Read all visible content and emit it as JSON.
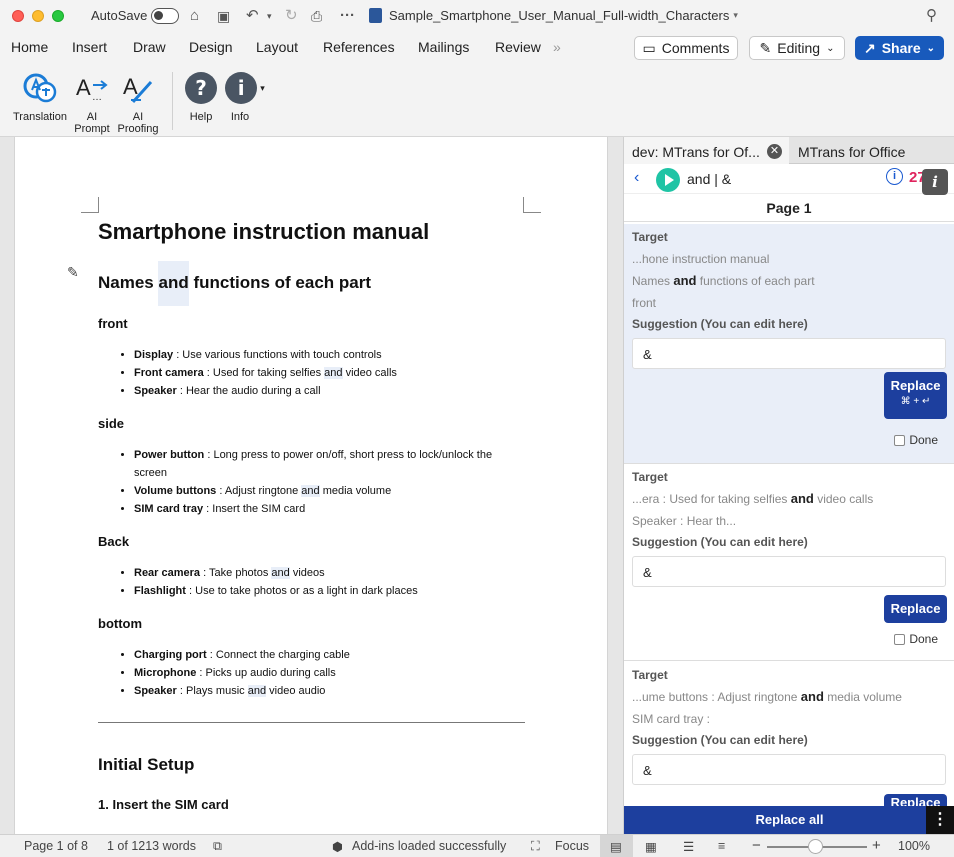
{
  "titlebar": {
    "autosave_label": "AutoSave",
    "document_name": "Sample_Smartphone_User_Manual_Full-width_Characters",
    "icons": [
      "home-icon",
      "save-icon",
      "undo-icon",
      "redo-icon",
      "print-icon",
      "more-icon",
      "search-icon"
    ],
    "more_glyph": "···"
  },
  "menu": {
    "tabs": [
      "Home",
      "Insert",
      "Draw",
      "Design",
      "Layout",
      "References",
      "Mailings",
      "Review"
    ],
    "overflow_glyph": "»",
    "comments_label": "Comments",
    "editing_label": "Editing",
    "share_label": "Share"
  },
  "ribbon": {
    "translation_label": "Translation",
    "ai_prompt_label": "AI Prompt",
    "ai_proofing_label": "AI Proofing",
    "help_label": "Help",
    "info_label": "Info"
  },
  "document": {
    "title": "Smartphone instruction manual",
    "section1": "Names and functions of each part",
    "sec1_pre": "Names ",
    "sec1_hl": "and",
    "sec1_post": " functions of each part",
    "groups": [
      {
        "heading": "front",
        "items": [
          {
            "term": "Display",
            "desc": " : Use various functions with touch controls"
          },
          {
            "term": "Front camera",
            "desc": " : Used for taking selfies and video calls"
          },
          {
            "term": "Speaker",
            "desc": " : Hear the audio during a call"
          }
        ]
      },
      {
        "heading": "side",
        "items": [
          {
            "term": "Power button",
            "desc": " : Long press to power on/off, short press to lock/unlock the screen"
          },
          {
            "term": "Volume buttons",
            "desc": " : Adjust ringtone and media volume"
          },
          {
            "term": "SIM card tray",
            "desc": " : Insert the SIM card"
          }
        ]
      },
      {
        "heading": "Back",
        "items": [
          {
            "term": "Rear camera",
            "desc": " : Take photos and videos"
          },
          {
            "term": "Flashlight",
            "desc": " : Use to take photos or as a light in dark places"
          }
        ]
      },
      {
        "heading": "bottom",
        "items": [
          {
            "term": "Charging port",
            "desc": " : Connect the charging cable"
          },
          {
            "term": "Microphone",
            "desc": " : Picks up audio during calls"
          },
          {
            "term": "Speaker",
            "desc": " : Plays music and video audio"
          }
        ]
      }
    ],
    "section2": "Initial Setup",
    "subsection": "1. Insert the SIM card"
  },
  "pane": {
    "tab_active": "dev: MTrans for Of...",
    "tab_other": "MTrans for Office",
    "query": "and | &",
    "count": "27",
    "page_header": "Page 1",
    "target_label": "Target",
    "suggestion_label": "Suggestion (You can edit here)",
    "replace_label": "Replace",
    "replace_shortcut": "⌘ + ↵",
    "done_label": "Done",
    "replace_all_label": "Replace all",
    "cards": [
      {
        "ctx1": "...hone instruction manual",
        "ctx2_pre": "Names ",
        "ctx2_hl": "and",
        "ctx2_post": " functions of each part",
        "ctx3": "front",
        "suggestion": "&"
      },
      {
        "ctx1_pre": "...era : Used for taking selfies ",
        "ctx1_hl": "and",
        "ctx1_post": " video calls",
        "ctx2": "Speaker : Hear th...",
        "suggestion": "&"
      },
      {
        "ctx1_pre": "...ume buttons : Adjust ringtone ",
        "ctx1_hl": "and",
        "ctx1_post": " media volume",
        "ctx2": "SIM card tray :",
        "suggestion": "&"
      }
    ]
  },
  "status": {
    "page": "Page 1 of 8",
    "words": "1 of 1213 words",
    "addins": "Add-ins loaded successfully",
    "focus": "Focus",
    "zoom": "100%"
  }
}
